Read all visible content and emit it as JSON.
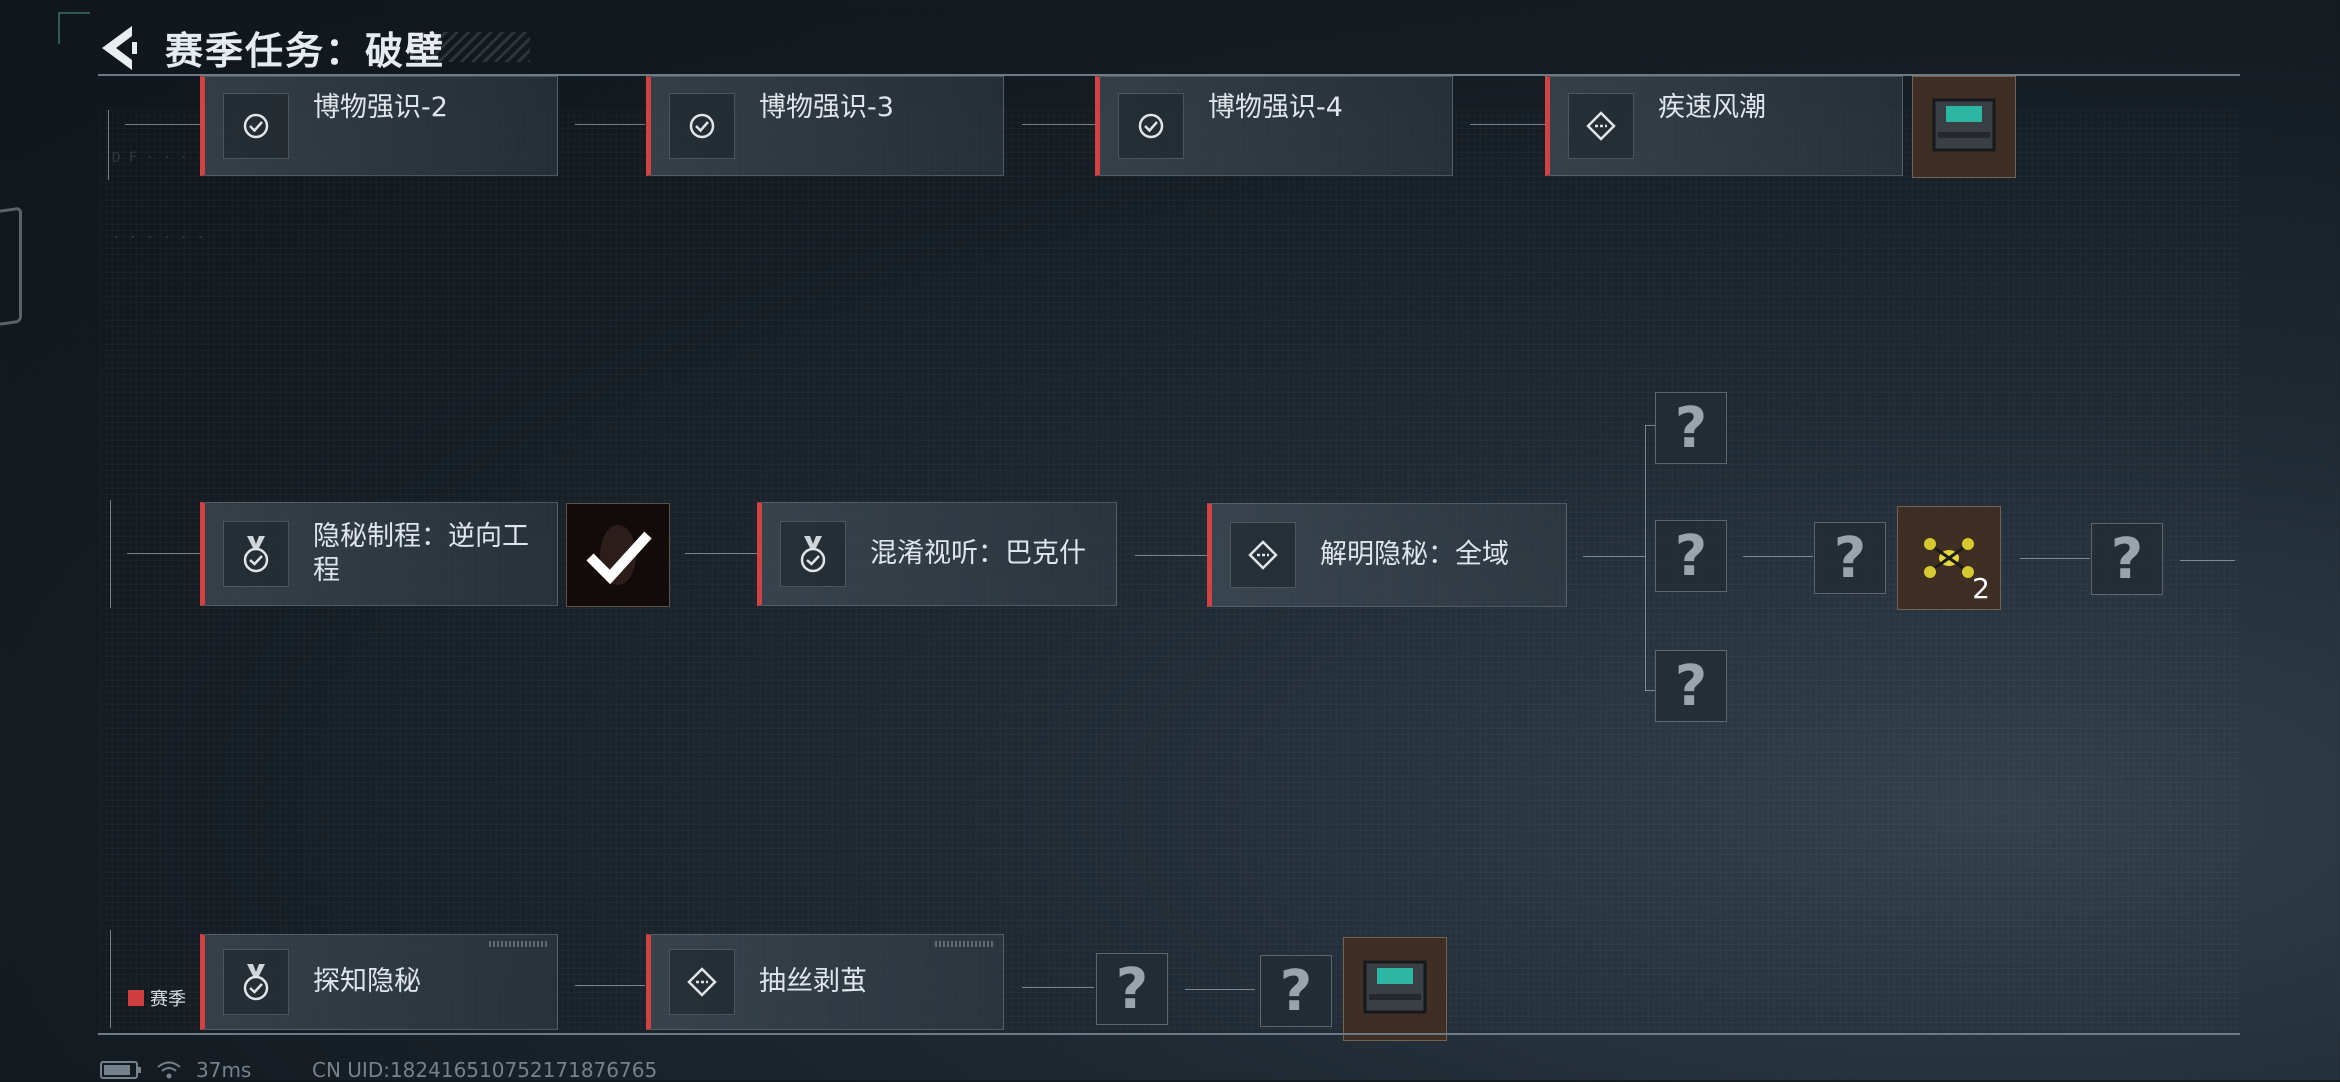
{
  "header": {
    "title": "赛季任务：破壁"
  },
  "top_row": [
    {
      "label": "博物强识-2",
      "icon": "check-circle-icon"
    },
    {
      "label": "博物强识-3",
      "icon": "check-circle-icon"
    },
    {
      "label": "博物强识-4",
      "icon": "check-circle-icon"
    },
    {
      "label": "疾速风潮",
      "icon": "diamond-dash-icon"
    }
  ],
  "middle_row": [
    {
      "label_line1": "隐秘制程：逆向工",
      "label_line2": "程",
      "icon": "medal-check-icon"
    },
    {
      "label": "混淆视听：巴克什",
      "icon": "medal-check-icon"
    },
    {
      "label": "解明隐秘：全域",
      "icon": "diamond-dash-icon"
    }
  ],
  "middle_rewards": {
    "unknown_glyph": "?",
    "reward_count": "2"
  },
  "bottom_row": [
    {
      "label": "探知隐秘",
      "icon": "medal-check-icon"
    },
    {
      "label": "抽丝剥茧",
      "icon": "diamond-dash-icon"
    }
  ],
  "season_tag": "赛季",
  "status_bar": {
    "ping": "37ms",
    "uid": "CN UID:182416510752171876765"
  },
  "colors": {
    "accent_red": "#d24242",
    "background": "#141b21"
  }
}
